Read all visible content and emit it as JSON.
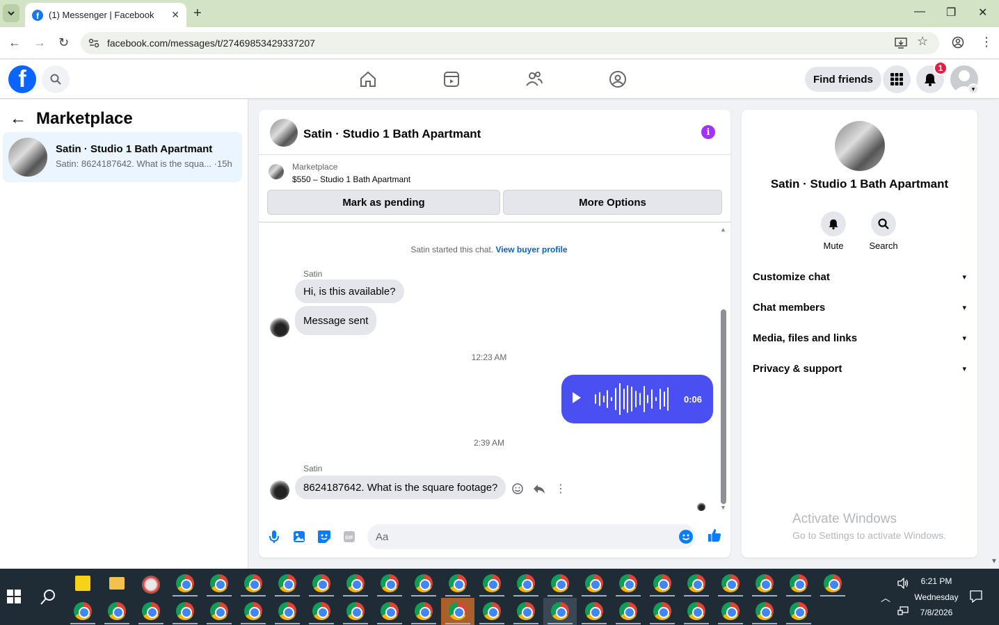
{
  "browser": {
    "tab_title": "(1) Messenger | Facebook",
    "url": "facebook.com/messages/t/27469853429337207"
  },
  "header": {
    "find_friends_label": "Find friends",
    "notification_count": "1"
  },
  "left_pane": {
    "title": "Marketplace",
    "conversation": {
      "name": "Satin · Studio 1 Bath Apartmant",
      "preview": "Satin: 8624187642. What is the squa... ·15h"
    }
  },
  "chat": {
    "title": "Satin · Studio 1 Bath Apartmant",
    "marketplace_label": "Marketplace",
    "listing": "$550 – Studio 1 Bath Apartmant",
    "mark_pending_label": "Mark as pending",
    "more_options_label": "More Options",
    "system_message": "Satin started this chat.",
    "view_buyer_profile": "View buyer profile",
    "sender_name": "Satin",
    "msg1": "Hi, is this available?",
    "msg2": "Message sent",
    "time1": "12:23 AM",
    "voice_duration": "0:06",
    "time2": "2:39 AM",
    "msg3": "8624187642.  What is the square footage?",
    "composer_placeholder": "Aa"
  },
  "right_pane": {
    "name": "Satin · Studio 1 Bath Apartmant",
    "mute_label": "Mute",
    "search_label": "Search",
    "items": [
      {
        "label": "Customize chat"
      },
      {
        "label": "Chat members"
      },
      {
        "label": "Media, files and links"
      },
      {
        "label": "Privacy & support"
      }
    ],
    "watermark_title": "Activate Windows",
    "watermark_sub": "Go to Settings to activate Windows."
  },
  "taskbar": {
    "time": "6:21 PM",
    "day": "Wednesday",
    "date": "7/8/2026"
  },
  "colors": {
    "facebook_blue": "#0866ff",
    "voice_bubble": "#4a4ff2",
    "notification_red": "#e41e3f",
    "info_purple": "#a033ff"
  }
}
